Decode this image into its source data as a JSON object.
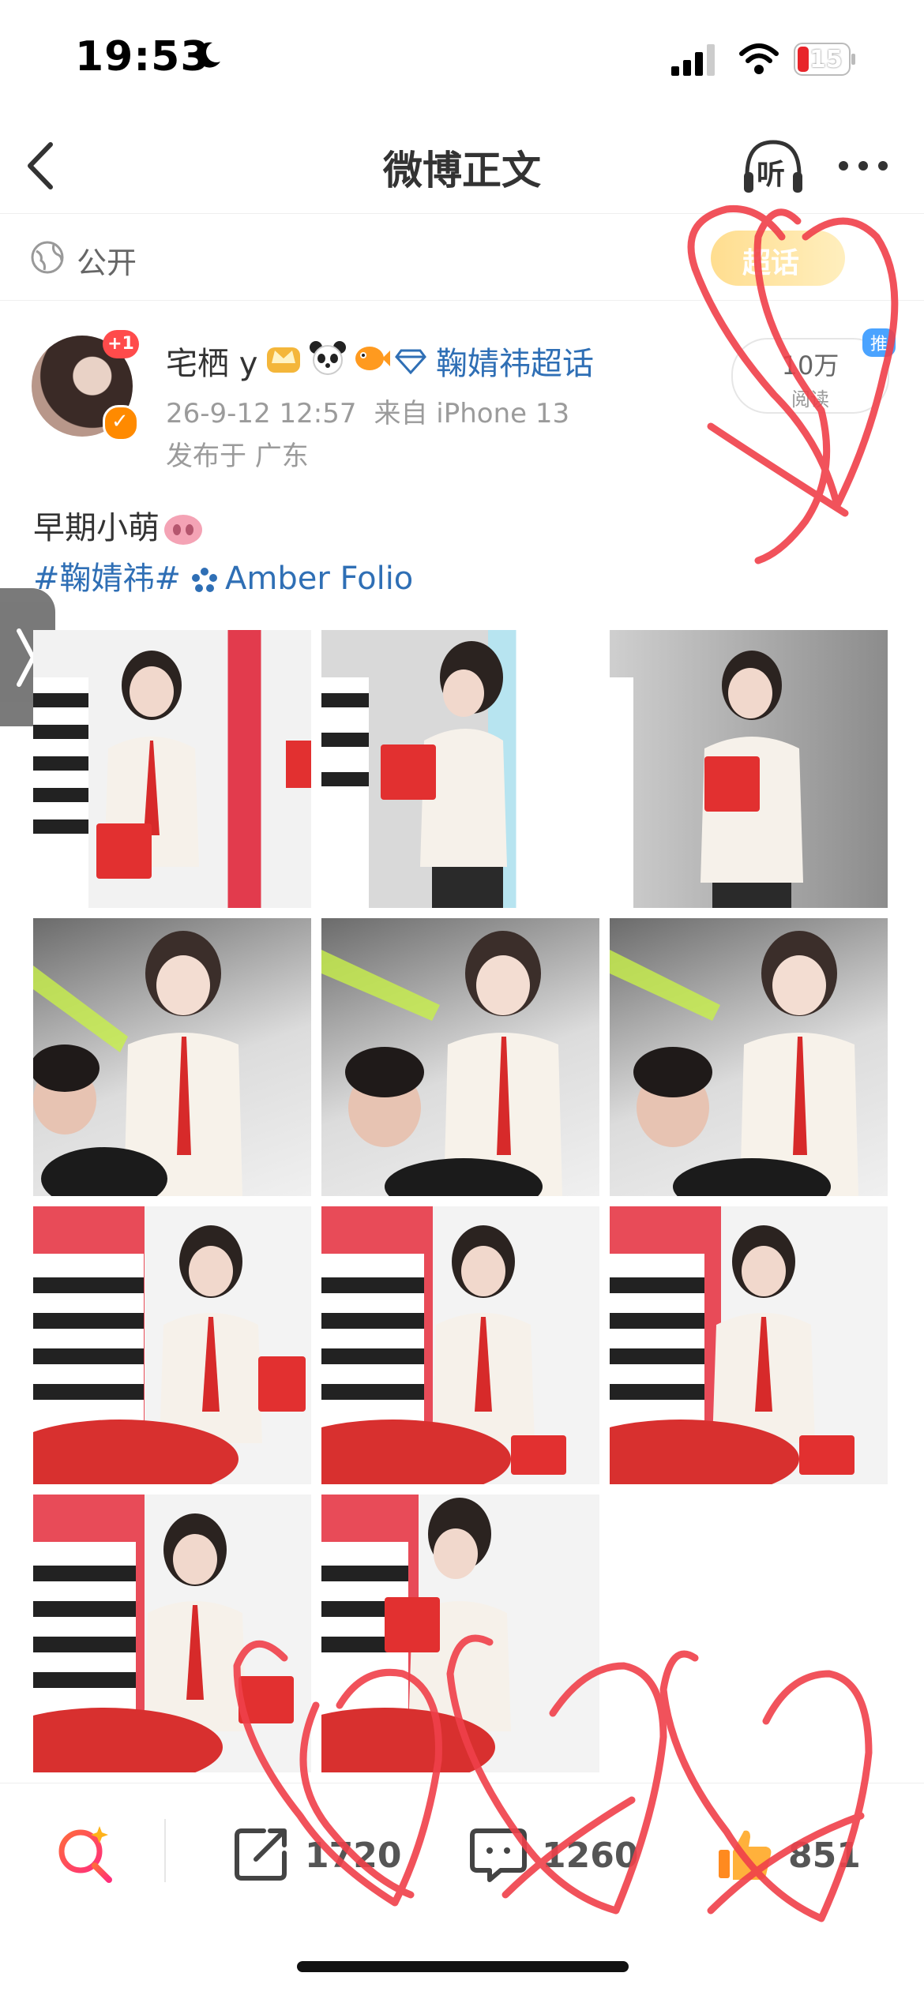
{
  "status_bar": {
    "time": "19:53",
    "battery": "15"
  },
  "nav": {
    "title": "微博正文",
    "listen_label": "听"
  },
  "visibility": {
    "label": "公开",
    "badge_text": "超话"
  },
  "author": {
    "avatar_badge": "+1",
    "name": "宅栖 y",
    "supertopic": "鞠婧祎超话",
    "time": "26-9-12 12:57",
    "source": "来自 iPhone 13",
    "location": "发布于 广东",
    "reads_count": "10万",
    "reads_label": "阅读",
    "push_label": "推"
  },
  "post": {
    "text": "早期小萌",
    "hashtag": "#鞠婧祎#",
    "super_link": "Amber Folio"
  },
  "toolbar": {
    "repost_count": "1720",
    "comment_count": "1260",
    "like_count": "851"
  },
  "colors": {
    "link": "#2f6fb5",
    "accent_red": "#e8242a",
    "scribble": "#f0404a"
  },
  "photos": [
    "photo-1",
    "photo-2",
    "photo-3",
    "photo-4",
    "photo-5",
    "photo-6",
    "photo-7",
    "photo-8",
    "photo-9",
    "photo-10",
    "photo-11"
  ]
}
